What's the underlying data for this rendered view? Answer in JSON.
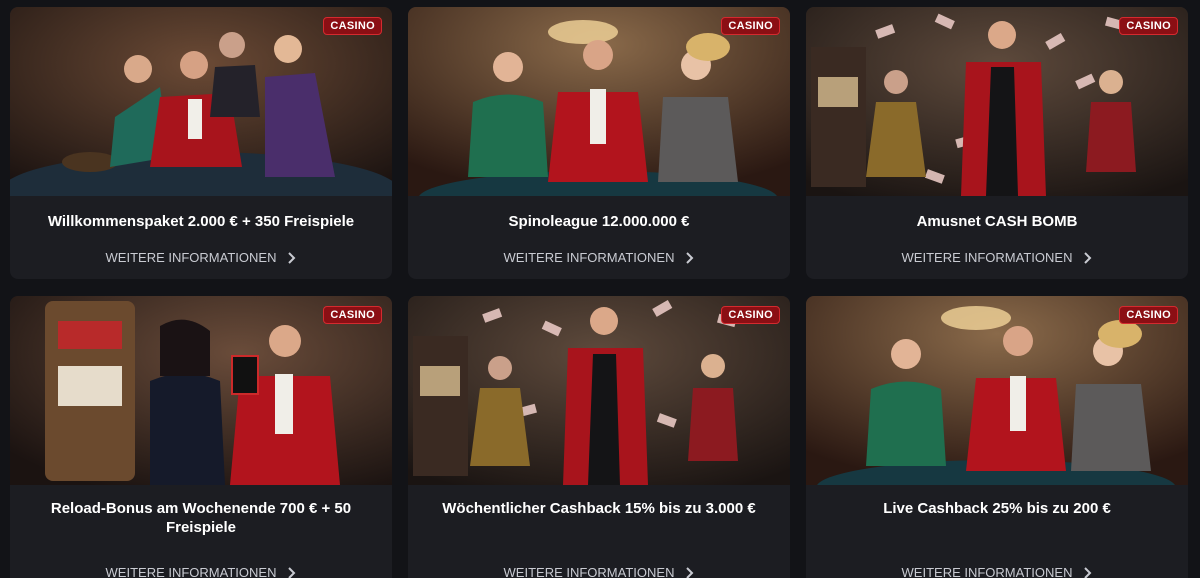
{
  "promotions": [
    {
      "badge": "CASINO",
      "title": "Willkommenspaket 2.000 € + 350 Freispiele",
      "cta": "WEITERE INFORMATIONEN",
      "scene": "roulette"
    },
    {
      "badge": "CASINO",
      "title": "Spinoleague 12.000.000 €",
      "cta": "WEITERE INFORMATIONEN",
      "scene": "poker-table"
    },
    {
      "badge": "CASINO",
      "title": "Amusnet CASH BOMB",
      "cta": "WEITERE INFORMATIONEN",
      "scene": "money-rain"
    },
    {
      "badge": "CASINO",
      "title": "Reload-Bonus am Wochenende 700 € + 50 Freispiele",
      "cta": "WEITERE INFORMATIONEN",
      "scene": "slot-machine"
    },
    {
      "badge": "CASINO",
      "title": "Wöchentlicher Cashback 15% bis zu 3.000 €",
      "cta": "WEITERE INFORMATIONEN",
      "scene": "money-rain"
    },
    {
      "badge": "CASINO",
      "title": "Live Cashback 25% bis zu 200 €",
      "cta": "WEITERE INFORMATIONEN",
      "scene": "poker-table"
    }
  ],
  "colors": {
    "background": "#121317",
    "card": "#1c1d22",
    "badge": "#8b0f14",
    "badge_border": "#d42a2f",
    "cta_text": "#c9cbd2"
  },
  "icons": {
    "cta": "chevron-right-icon"
  }
}
